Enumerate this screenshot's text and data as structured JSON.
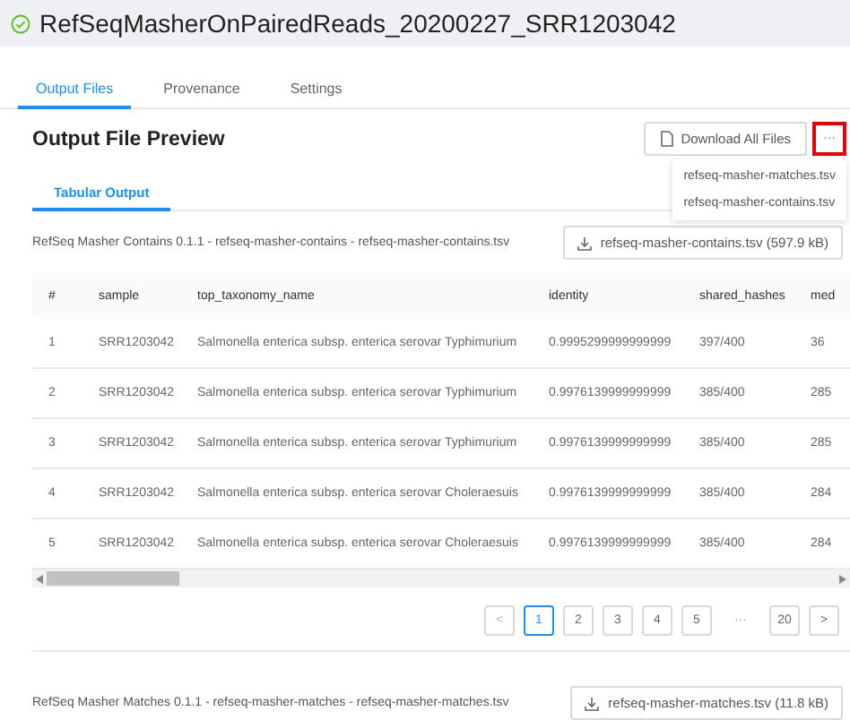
{
  "header": {
    "title": "RefSeqMasherOnPairedReads_20200227_SRR1203042"
  },
  "tabs": [
    {
      "label": "Output Files",
      "selected": true
    },
    {
      "label": "Provenance",
      "selected": false
    },
    {
      "label": "Settings",
      "selected": false
    }
  ],
  "preview": {
    "title": "Output File Preview",
    "download_all": "Download All Files",
    "more": "···",
    "menu": [
      "refseq-masher-matches.tsv",
      "refseq-masher-contains.tsv"
    ],
    "subtabs": [
      {
        "label": "Tabular Output",
        "selected": true
      }
    ]
  },
  "files": [
    {
      "description": "RefSeq Masher Contains 0.1.1 - refseq-masher-contains - refseq-masher-contains.tsv",
      "download": "refseq-masher-contains.tsv (597.9 kB)",
      "table": {
        "columns": [
          "#",
          "sample",
          "top_taxonomy_name",
          "identity",
          "shared_hashes",
          "med"
        ],
        "rows": [
          [
            "1",
            "SRR1203042",
            "Salmonella enterica subsp. enterica serovar Typhimurium",
            "0.9995299999999999",
            "397/400",
            "36"
          ],
          [
            "2",
            "SRR1203042",
            "Salmonella enterica subsp. enterica serovar Typhimurium",
            "0.9976139999999999",
            "385/400",
            "285"
          ],
          [
            "3",
            "SRR1203042",
            "Salmonella enterica subsp. enterica serovar Typhimurium",
            "0.9976139999999999",
            "385/400",
            "285"
          ],
          [
            "4",
            "SRR1203042",
            "Salmonella enterica subsp. enterica serovar Choleraesuis",
            "0.9976139999999999",
            "385/400",
            "284"
          ],
          [
            "5",
            "SRR1203042",
            "Salmonella enterica subsp. enterica serovar Choleraesuis",
            "0.9976139999999999",
            "385/400",
            "284"
          ]
        ]
      },
      "pagination": {
        "prev": "<",
        "next": ">",
        "pages": [
          {
            "label": "1",
            "selected": true
          },
          {
            "label": "2",
            "selected": false
          },
          {
            "label": "3",
            "selected": false
          },
          {
            "label": "4",
            "selected": false
          },
          {
            "label": "5",
            "selected": false
          },
          {
            "label": "···",
            "kind": "ellipsis",
            "selected": false
          },
          {
            "label": "20",
            "selected": false
          }
        ]
      }
    },
    {
      "description": "RefSeq Masher Matches 0.1.1 - refseq-masher-matches - refseq-masher-matches.tsv",
      "download": "refseq-masher-matches.tsv (11.8 kB)"
    }
  ]
}
